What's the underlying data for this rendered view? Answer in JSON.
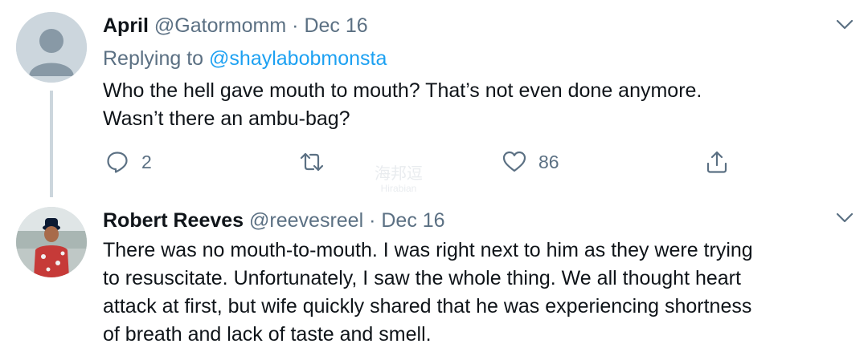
{
  "tweets": [
    {
      "name": "April",
      "handle": "@Gatormomm",
      "separator": "·",
      "date": "Dec 16",
      "replying_prefix": "Replying to",
      "replying_to": "@shaylabobmonsta",
      "body_lines": [
        "Who the hell gave mouth to mouth? That’s not even done anymore.",
        "Wasn’t there an ambu-bag?"
      ],
      "actions": {
        "reply_count": "2",
        "retweet_count": "",
        "like_count": "86"
      }
    },
    {
      "name": "Robert Reeves",
      "handle": "@reevesreel",
      "separator": "·",
      "date": "Dec 16",
      "body_lines": [
        "There was no mouth-to-mouth. I was right next to him as they were trying",
        "to resuscitate.  Unfortunately, I saw the whole thing.  We all thought heart",
        "attack at first, but wife quickly shared that he was experiencing shortness",
        "of breath and lack of taste and smell."
      ]
    }
  ],
  "watermark": {
    "text": "海邦逗",
    "subtext": "Hirabian"
  },
  "colors": {
    "text": "#0f1419",
    "secondary": "#5b7083",
    "link": "#1da1f2",
    "thread_line": "#ccd6dd"
  },
  "icons": {
    "reply": "reply-icon",
    "retweet": "retweet-icon",
    "like": "heart-icon",
    "share": "share-icon",
    "more": "chevron-down-icon"
  }
}
